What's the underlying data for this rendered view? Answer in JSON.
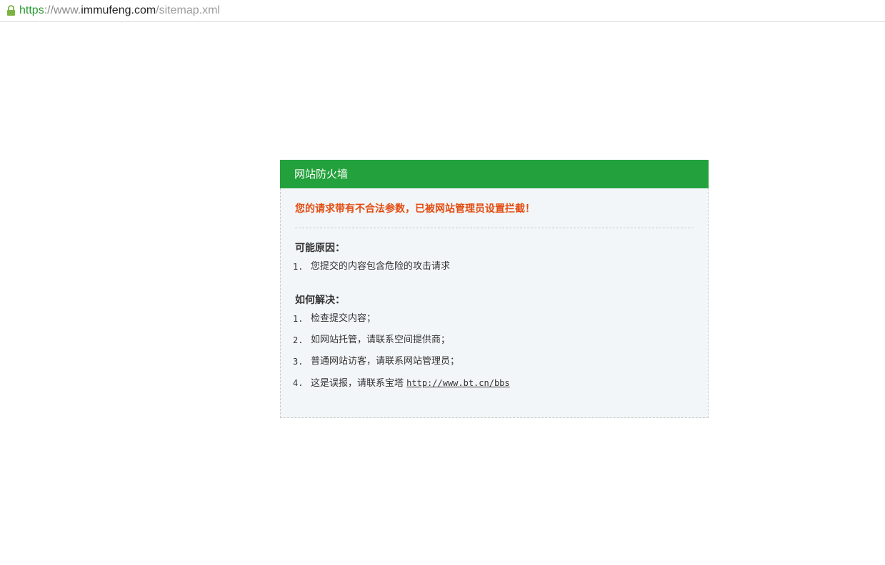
{
  "browser": {
    "url": {
      "scheme": "https",
      "separator": "://www.",
      "host": "immufeng.com",
      "path": "/sitemap.xml"
    },
    "lock_icon": "lock-icon"
  },
  "colors": {
    "header_green": "#23a13c",
    "alert_red": "#e24d12",
    "panel_bg": "#f3f6f8"
  },
  "panel": {
    "title": "网站防火墙",
    "alert": "您的请求带有不合法参数，已被网站管理员设置拦截！",
    "reasons": {
      "title": "可能原因：",
      "items": [
        {
          "num": "1.",
          "text": "您提交的内容包含危险的攻击请求"
        }
      ]
    },
    "solutions": {
      "title": "如何解决：",
      "items": [
        {
          "num": "1.",
          "text": "检查提交内容；"
        },
        {
          "num": "2.",
          "text": "如网站托管，请联系空间提供商；"
        },
        {
          "num": "3.",
          "text": "普通网站访客，请联系网站管理员；"
        },
        {
          "num": "4.",
          "text": "这是误报，请联系宝塔 ",
          "link": "http://www.bt.cn/bbs"
        }
      ]
    }
  }
}
